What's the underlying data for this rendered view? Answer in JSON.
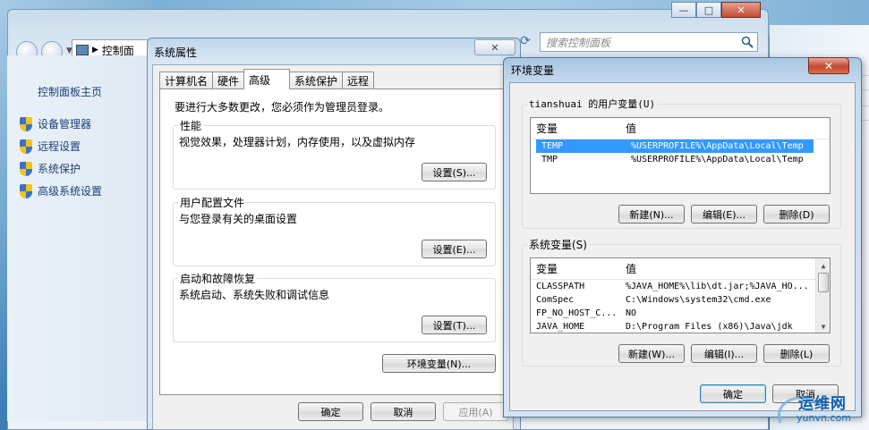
{
  "control_panel": {
    "address_text": "控制面",
    "search_placeholder": "搜索控制面板",
    "sidebar_home": "控制面板主页",
    "sidebar_items": [
      "设备管理器",
      "远程设置",
      "系统保护",
      "高级系统设置"
    ]
  },
  "system_properties": {
    "title": "系统属性",
    "close_glyph": "✕",
    "tabs": [
      "计算机名",
      "硬件",
      "高级",
      "系统保护",
      "远程"
    ],
    "active_tab": "高级",
    "intro": "要进行大多数更改，您必须作为管理员登录。",
    "groups": [
      {
        "title": "性能",
        "desc": "视觉效果，处理器计划，内存使用，以及虚拟内存",
        "button": "设置(S)..."
      },
      {
        "title": "用户配置文件",
        "desc": "与您登录有关的桌面设置",
        "button": "设置(E)..."
      },
      {
        "title": "启动和故障恢复",
        "desc": "系统启动、系统失败和调试信息",
        "button": "设置(T)..."
      }
    ],
    "env_button": "环境变量(N)...",
    "ok": "确定",
    "cancel": "取消",
    "apply": "应用(A)"
  },
  "environment_variables": {
    "title": "环境变量",
    "close_glyph": "✕",
    "user_group_title": "tianshuai 的用户变量(U)",
    "col_name": "变量",
    "col_value": "值",
    "user_vars": [
      {
        "name": "TEMP",
        "value": "%USERPROFILE%\\AppData\\Local\\Temp",
        "selected": true
      },
      {
        "name": "TMP",
        "value": "%USERPROFILE%\\AppData\\Local\\Temp",
        "selected": false
      }
    ],
    "user_buttons": {
      "new": "新建(N)...",
      "edit": "编辑(E)...",
      "delete": "删除(D)"
    },
    "system_group_title": "系统变量(S)",
    "system_vars": [
      {
        "name": "CLASSPATH",
        "value": "%JAVA_HOME%\\lib\\dt.jar;%JAVA_HO..."
      },
      {
        "name": "ComSpec",
        "value": "C:\\Windows\\system32\\cmd.exe"
      },
      {
        "name": "FP_NO_HOST_C...",
        "value": "NO"
      },
      {
        "name": "JAVA_HOME",
        "value": "D:\\Program Files (x86)\\Java\\jdk"
      }
    ],
    "system_buttons": {
      "new": "新建(W)...",
      "edit": "编辑(I)...",
      "delete": "删除(L)"
    },
    "ok": "确定",
    "cancel": "取消"
  },
  "watermark": {
    "text": "运维网",
    "url_text": "yunvn.com"
  }
}
